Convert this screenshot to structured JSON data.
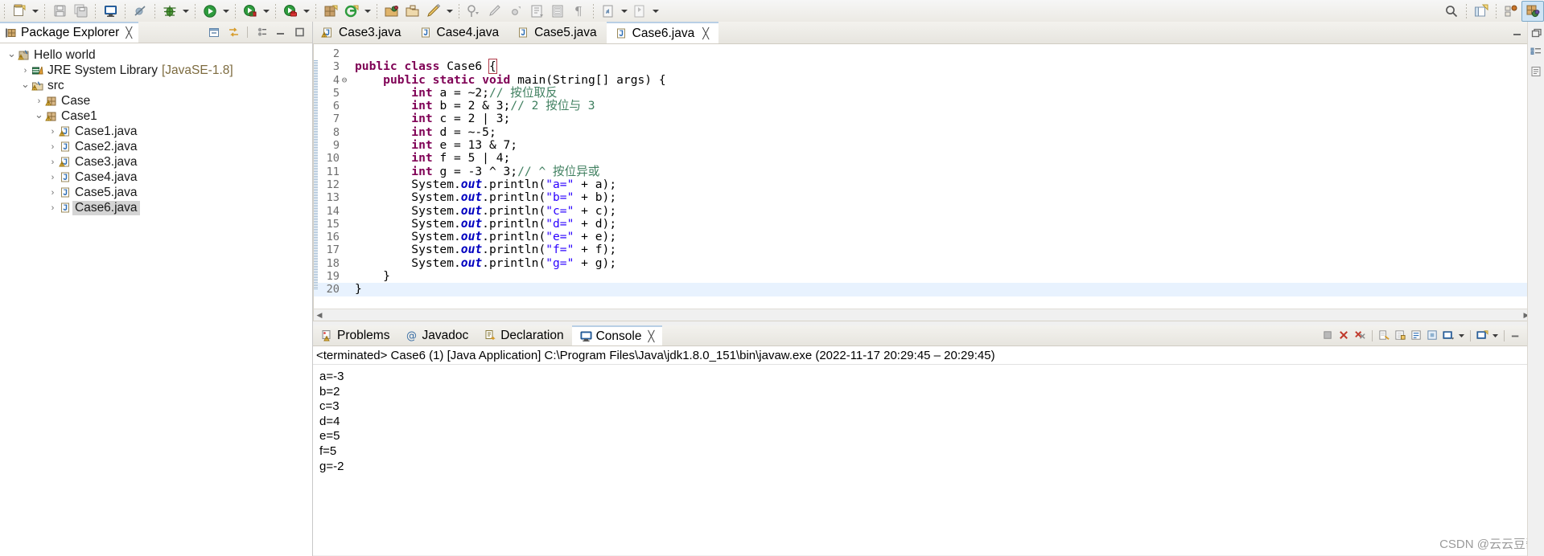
{
  "toolbar": {
    "groups": [
      {
        "items": [
          {
            "name": "new-icon",
            "arrow": true
          },
          {
            "name": "save-icon",
            "arrow": false
          },
          {
            "name": "save-all-icon",
            "arrow": false
          }
        ]
      },
      {
        "items": [
          {
            "name": "new-java-console-icon",
            "arrow": false
          }
        ]
      },
      {
        "items": [
          {
            "name": "skip-breakpoints-icon",
            "arrow": false
          }
        ]
      },
      {
        "items": [
          {
            "name": "debug-icon",
            "arrow": true
          }
        ]
      },
      {
        "items": [
          {
            "name": "run-icon",
            "arrow": true
          }
        ]
      },
      {
        "items": [
          {
            "name": "coverage-icon",
            "arrow": true
          }
        ]
      },
      {
        "items": [
          {
            "name": "run-external-tools-icon",
            "arrow": true
          }
        ]
      },
      {
        "items": [
          {
            "name": "new-java-project-icon",
            "arrow": false
          },
          {
            "name": "new-java-class-icon",
            "arrow": true
          }
        ]
      },
      {
        "items": [
          {
            "name": "open-type-icon",
            "arrow": false
          },
          {
            "name": "open-task-icon",
            "arrow": false
          },
          {
            "name": "search-declaration-icon",
            "arrow": false
          }
        ]
      },
      {
        "items": [
          {
            "name": "next-annotation-icon",
            "arrow": false
          },
          {
            "name": "previous-annotation-icon",
            "arrow": false
          },
          {
            "name": "last-edit-location-icon",
            "arrow": false
          }
        ]
      },
      {
        "items": [
          {
            "name": "back-icon",
            "arrow": true
          },
          {
            "name": "forward-icon",
            "arrow": true
          },
          {
            "name": "pin-editor-icon",
            "arrow": false
          }
        ]
      }
    ],
    "right_items": [
      {
        "name": "quick-access-search-icon"
      },
      {
        "name": "open-perspective-icon"
      },
      {
        "name": "java-ee-perspective-icon"
      },
      {
        "name": "java-perspective-icon"
      }
    ]
  },
  "sidebar": {
    "tab": {
      "label": "Package Explorer",
      "close": "╳",
      "icon": "package-explorer-icon"
    },
    "tools": [
      {
        "name": "collapse-all-icon"
      },
      {
        "name": "link-with-editor-icon"
      },
      {
        "name": "view-menu-icon"
      },
      {
        "name": "minimize-view-icon"
      },
      {
        "name": "maximize-view-icon"
      }
    ],
    "tree": [
      {
        "indent": 1,
        "twisty": "⌄",
        "icon": "java-project-icon",
        "label": "Hello world",
        "sub": "",
        "selected": false,
        "warning": true
      },
      {
        "indent": 2,
        "twisty": "›",
        "icon": "jre-library-icon",
        "label": "JRE System Library",
        "sub": "[JavaSE-1.8]",
        "selected": false,
        "warning": false
      },
      {
        "indent": 2,
        "twisty": "⌄",
        "icon": "source-folder-icon",
        "label": "src",
        "sub": "",
        "selected": false,
        "warning": true
      },
      {
        "indent": 3,
        "twisty": "›",
        "icon": "package-icon",
        "label": "Case",
        "sub": "",
        "selected": false,
        "warning": true
      },
      {
        "indent": 3,
        "twisty": "⌄",
        "icon": "package-icon",
        "label": "Case1",
        "sub": "",
        "selected": false,
        "warning": true
      },
      {
        "indent": 4,
        "twisty": "›",
        "icon": "java-file-icon",
        "label": "Case1.java",
        "sub": "",
        "selected": false,
        "warning": true
      },
      {
        "indent": 4,
        "twisty": "›",
        "icon": "java-file-icon",
        "label": "Case2.java",
        "sub": "",
        "selected": false,
        "warning": false
      },
      {
        "indent": 4,
        "twisty": "›",
        "icon": "java-file-icon",
        "label": "Case3.java",
        "sub": "",
        "selected": false,
        "warning": true
      },
      {
        "indent": 4,
        "twisty": "›",
        "icon": "java-file-icon",
        "label": "Case4.java",
        "sub": "",
        "selected": false,
        "warning": false
      },
      {
        "indent": 4,
        "twisty": "›",
        "icon": "java-file-icon",
        "label": "Case5.java",
        "sub": "",
        "selected": false,
        "warning": false
      },
      {
        "indent": 4,
        "twisty": "›",
        "icon": "java-file-icon",
        "label": "Case6.java",
        "sub": "",
        "selected": true,
        "warning": false
      }
    ]
  },
  "editor": {
    "tabs": [
      {
        "label": "Case3.java",
        "active": false,
        "warning": true,
        "close": ""
      },
      {
        "label": "Case4.java",
        "active": false,
        "warning": false,
        "close": ""
      },
      {
        "label": "Case5.java",
        "active": false,
        "warning": false,
        "close": ""
      },
      {
        "label": "Case6.java",
        "active": true,
        "warning": false,
        "close": "╳"
      }
    ],
    "right_buttons": [
      {
        "name": "minimize-editor-icon"
      },
      {
        "name": "maximize-editor-icon"
      }
    ],
    "code_lines": [
      {
        "num": "2",
        "fold": "",
        "highlight": false,
        "tokens": []
      },
      {
        "num": "3",
        "fold": "",
        "highlight": false,
        "tokens": [
          {
            "t": "public",
            "c": "kw"
          },
          {
            "t": " ",
            "c": ""
          },
          {
            "t": "class",
            "c": "kw"
          },
          {
            "t": " Case6 ",
            "c": ""
          },
          {
            "t": "{",
            "c": "brkt"
          }
        ]
      },
      {
        "num": "4",
        "fold": "⊖",
        "highlight": false,
        "tokens": [
          {
            "t": "    ",
            "c": ""
          },
          {
            "t": "public",
            "c": "kw"
          },
          {
            "t": " ",
            "c": ""
          },
          {
            "t": "static",
            "c": "kw"
          },
          {
            "t": " ",
            "c": ""
          },
          {
            "t": "void",
            "c": "kw"
          },
          {
            "t": " main(String[] args) {",
            "c": ""
          }
        ]
      },
      {
        "num": "5",
        "fold": "",
        "highlight": false,
        "tokens": [
          {
            "t": "        ",
            "c": ""
          },
          {
            "t": "int",
            "c": "kw"
          },
          {
            "t": " a = ~2;",
            "c": ""
          },
          {
            "t": "// 按位取反",
            "c": "cmt"
          }
        ]
      },
      {
        "num": "6",
        "fold": "",
        "highlight": false,
        "tokens": [
          {
            "t": "        ",
            "c": ""
          },
          {
            "t": "int",
            "c": "kw"
          },
          {
            "t": " b = 2 & 3;",
            "c": ""
          },
          {
            "t": "// 2 按位与 3",
            "c": "cmt"
          }
        ]
      },
      {
        "num": "7",
        "fold": "",
        "highlight": false,
        "tokens": [
          {
            "t": "        ",
            "c": ""
          },
          {
            "t": "int",
            "c": "kw"
          },
          {
            "t": " c = 2 | 3;",
            "c": ""
          }
        ]
      },
      {
        "num": "8",
        "fold": "",
        "highlight": false,
        "tokens": [
          {
            "t": "        ",
            "c": ""
          },
          {
            "t": "int",
            "c": "kw"
          },
          {
            "t": " d = ~-5;",
            "c": ""
          }
        ]
      },
      {
        "num": "9",
        "fold": "",
        "highlight": false,
        "tokens": [
          {
            "t": "        ",
            "c": ""
          },
          {
            "t": "int",
            "c": "kw"
          },
          {
            "t": " e = 13 & 7;",
            "c": ""
          }
        ]
      },
      {
        "num": "10",
        "fold": "",
        "highlight": false,
        "tokens": [
          {
            "t": "        ",
            "c": ""
          },
          {
            "t": "int",
            "c": "kw"
          },
          {
            "t": " f = 5 | 4;",
            "c": ""
          }
        ]
      },
      {
        "num": "11",
        "fold": "",
        "highlight": false,
        "tokens": [
          {
            "t": "        ",
            "c": ""
          },
          {
            "t": "int",
            "c": "kw"
          },
          {
            "t": " g = -3 ^ 3;",
            "c": ""
          },
          {
            "t": "// ^ 按位异或",
            "c": "cmt"
          }
        ]
      },
      {
        "num": "12",
        "fold": "",
        "highlight": false,
        "tokens": [
          {
            "t": "        System.",
            "c": ""
          },
          {
            "t": "out",
            "c": "fld"
          },
          {
            "t": ".println(",
            "c": ""
          },
          {
            "t": "\"a=\"",
            "c": "str"
          },
          {
            "t": " + a);",
            "c": ""
          }
        ]
      },
      {
        "num": "13",
        "fold": "",
        "highlight": false,
        "tokens": [
          {
            "t": "        System.",
            "c": ""
          },
          {
            "t": "out",
            "c": "fld"
          },
          {
            "t": ".println(",
            "c": ""
          },
          {
            "t": "\"b=\"",
            "c": "str"
          },
          {
            "t": " + b);",
            "c": ""
          }
        ]
      },
      {
        "num": "14",
        "fold": "",
        "highlight": false,
        "tokens": [
          {
            "t": "        System.",
            "c": ""
          },
          {
            "t": "out",
            "c": "fld"
          },
          {
            "t": ".println(",
            "c": ""
          },
          {
            "t": "\"c=\"",
            "c": "str"
          },
          {
            "t": " + c);",
            "c": ""
          }
        ]
      },
      {
        "num": "15",
        "fold": "",
        "highlight": false,
        "tokens": [
          {
            "t": "        System.",
            "c": ""
          },
          {
            "t": "out",
            "c": "fld"
          },
          {
            "t": ".println(",
            "c": ""
          },
          {
            "t": "\"d=\"",
            "c": "str"
          },
          {
            "t": " + d);",
            "c": ""
          }
        ]
      },
      {
        "num": "16",
        "fold": "",
        "highlight": false,
        "tokens": [
          {
            "t": "        System.",
            "c": ""
          },
          {
            "t": "out",
            "c": "fld"
          },
          {
            "t": ".println(",
            "c": ""
          },
          {
            "t": "\"e=\"",
            "c": "str"
          },
          {
            "t": " + e);",
            "c": ""
          }
        ]
      },
      {
        "num": "17",
        "fold": "",
        "highlight": false,
        "tokens": [
          {
            "t": "        System.",
            "c": ""
          },
          {
            "t": "out",
            "c": "fld"
          },
          {
            "t": ".println(",
            "c": ""
          },
          {
            "t": "\"f=\"",
            "c": "str"
          },
          {
            "t": " + f);",
            "c": ""
          }
        ]
      },
      {
        "num": "18",
        "fold": "",
        "highlight": false,
        "tokens": [
          {
            "t": "        System.",
            "c": ""
          },
          {
            "t": "out",
            "c": "fld"
          },
          {
            "t": ".println(",
            "c": ""
          },
          {
            "t": "\"g=\"",
            "c": "str"
          },
          {
            "t": " + g);",
            "c": ""
          }
        ]
      },
      {
        "num": "19",
        "fold": "",
        "highlight": false,
        "tokens": [
          {
            "t": "    }",
            "c": ""
          }
        ]
      },
      {
        "num": "20",
        "fold": "",
        "highlight": true,
        "tokens": [
          {
            "t": "}",
            "c": ""
          }
        ]
      }
    ]
  },
  "console": {
    "tabs": [
      {
        "label": "Problems",
        "icon": "problems-icon",
        "active": false,
        "close": ""
      },
      {
        "label": "Javadoc",
        "icon": "javadoc-icon",
        "active": false,
        "close": ""
      },
      {
        "label": "Declaration",
        "icon": "declaration-icon",
        "active": false,
        "close": ""
      },
      {
        "label": "Console",
        "icon": "console-icon",
        "active": true,
        "close": "╳"
      }
    ],
    "tools": [
      {
        "name": "terminate-icon"
      },
      {
        "name": "remove-launch-icon"
      },
      {
        "name": "remove-all-terminated-icon"
      },
      {
        "name": "clear-console-icon"
      },
      {
        "name": "scroll-lock-icon"
      },
      {
        "name": "word-wrap-icon"
      },
      {
        "name": "pin-console-icon"
      },
      {
        "name": "display-selected-console-icon"
      },
      {
        "name": "open-console-icon"
      },
      {
        "name": "minimize-console-icon"
      },
      {
        "name": "maximize-console-icon"
      }
    ],
    "status_line": "<terminated> Case6 (1) [Java Application] C:\\Program Files\\Java\\jdk1.8.0_151\\bin\\javaw.exe  (2022-11-17 20:29:45 – 20:29:45)",
    "output": [
      "a=-3",
      "b=2",
      "c=3",
      "d=4",
      "e=5",
      "f=5",
      "g=-2"
    ]
  },
  "watermark": "CSDN @云云豆酱",
  "right_rail": [
    {
      "name": "restore-icon"
    },
    {
      "name": "outline-view-icon"
    },
    {
      "name": "task-list-icon"
    }
  ]
}
